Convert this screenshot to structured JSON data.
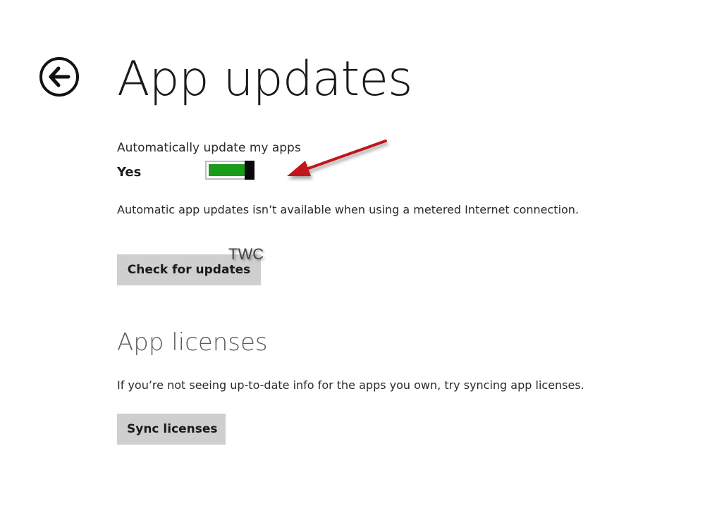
{
  "header": {
    "title": "App updates",
    "back_icon": "back-arrow-icon"
  },
  "auto_update": {
    "label": "Automatically update my apps",
    "state_text": "Yes",
    "enabled": true,
    "accent_color": "#1a9b1a",
    "info": "Automatic app updates isn’t available when using a metered Internet connection."
  },
  "actions": {
    "check_label": "Check for updates",
    "sync_label": "Sync licenses"
  },
  "licenses": {
    "title": "App licenses",
    "info": "If you’re not seeing up-to-date info for the apps you own, try syncing app licenses."
  },
  "watermark": "TWC",
  "annotation": {
    "type": "red-arrow",
    "color": "#c0151b"
  }
}
